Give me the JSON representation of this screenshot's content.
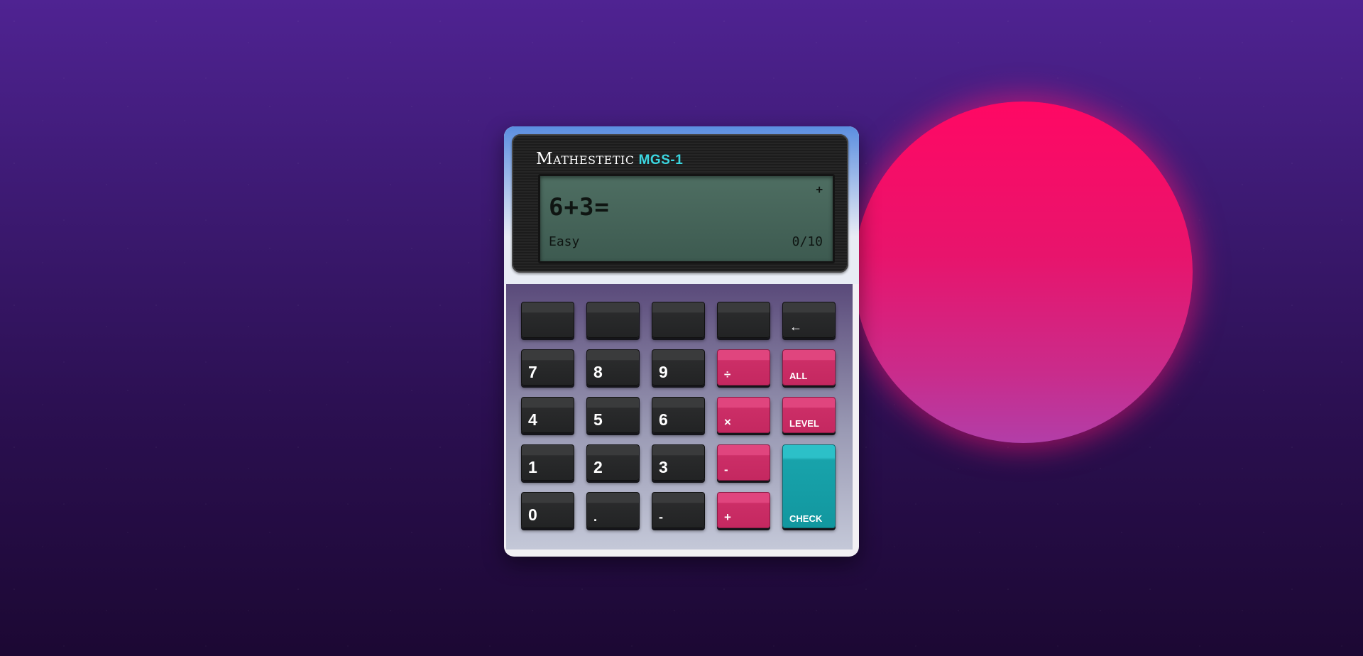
{
  "app": {
    "brand": "Mathestetic",
    "model": "MGS-1"
  },
  "display": {
    "indicator": "+",
    "expression": "6+3=",
    "level": "Easy",
    "score": "0/10"
  },
  "keys": {
    "blank1": "",
    "blank2": "",
    "blank3": "",
    "blank4": "",
    "back": "←",
    "seven": "7",
    "eight": "8",
    "nine": "9",
    "divide": "÷",
    "all": "ALL",
    "four": "4",
    "five": "5",
    "six": "6",
    "multiply": "×",
    "level": "LEVEL",
    "one": "1",
    "two": "2",
    "three": "3",
    "minus": "-",
    "zero": "0",
    "decimal": ".",
    "negative": "-",
    "plus": "+",
    "check": "CHECK"
  },
  "colors": {
    "sun_top": "#ff0864",
    "sun_bottom": "#b23ea8",
    "accent_pink": "#cc2e67",
    "accent_teal": "#18a3ab",
    "model_color": "#3bd6e0"
  }
}
